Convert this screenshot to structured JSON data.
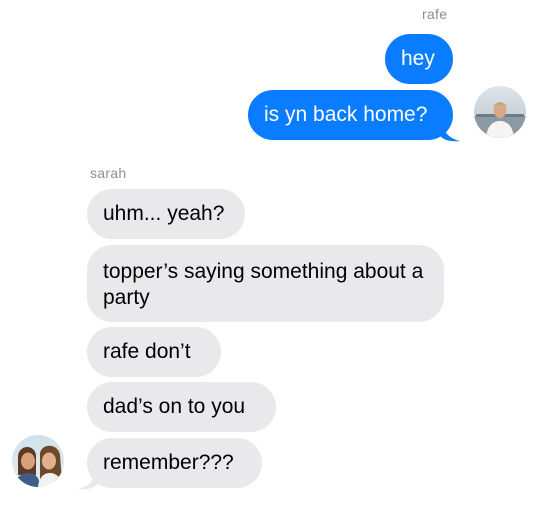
{
  "thread": {
    "outgoing_sender": "rafe",
    "incoming_sender": "sarah",
    "outgoing_messages": [
      {
        "text": "hey"
      },
      {
        "text": "is yn back home?"
      }
    ],
    "incoming_messages": [
      {
        "text": "uhm... yeah?"
      },
      {
        "text": "topper’s saying something about a party"
      },
      {
        "text": "rafe don’t"
      },
      {
        "text": "dad’s on to you"
      },
      {
        "text": "remember???"
      }
    ]
  },
  "colors": {
    "outgoing_bubble": "#0a7cff",
    "incoming_bubble": "#e9e9eb",
    "sender_name": "#8e8e93"
  },
  "icons": {
    "outgoing_avatar": "avatar-photo-man",
    "incoming_avatar": "avatar-photo-couple"
  }
}
